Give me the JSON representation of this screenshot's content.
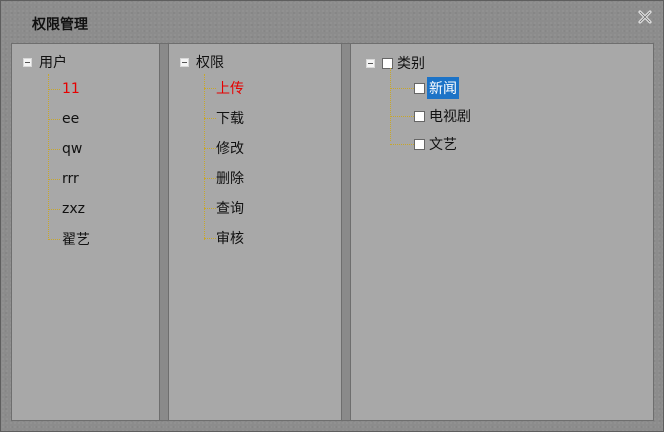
{
  "dialog": {
    "title": "权限管理",
    "close_icon": "close-icon"
  },
  "users": {
    "root_label": "用户",
    "items": [
      {
        "label": "11",
        "selected": true
      },
      {
        "label": "ee",
        "selected": false
      },
      {
        "label": "qw",
        "selected": false
      },
      {
        "label": "rrr",
        "selected": false
      },
      {
        "label": "zxz",
        "selected": false
      },
      {
        "label": "翟艺",
        "selected": false
      }
    ]
  },
  "permissions": {
    "root_label": "权限",
    "items": [
      {
        "label": "上传",
        "selected": true
      },
      {
        "label": "下载",
        "selected": false
      },
      {
        "label": "修改",
        "selected": false
      },
      {
        "label": "删除",
        "selected": false
      },
      {
        "label": "查询",
        "selected": false
      },
      {
        "label": "审核",
        "selected": false
      }
    ]
  },
  "categories": {
    "root_label": "类别",
    "items": [
      {
        "label": "新闻",
        "highlighted": true
      },
      {
        "label": "电视剧",
        "highlighted": false
      },
      {
        "label": "文艺",
        "highlighted": false
      }
    ]
  },
  "colors": {
    "selected_text": "#e60000",
    "highlight_bg": "#1c73c7",
    "tree_line": "#c8a72a",
    "panel_bg": "#a8a8a8"
  }
}
